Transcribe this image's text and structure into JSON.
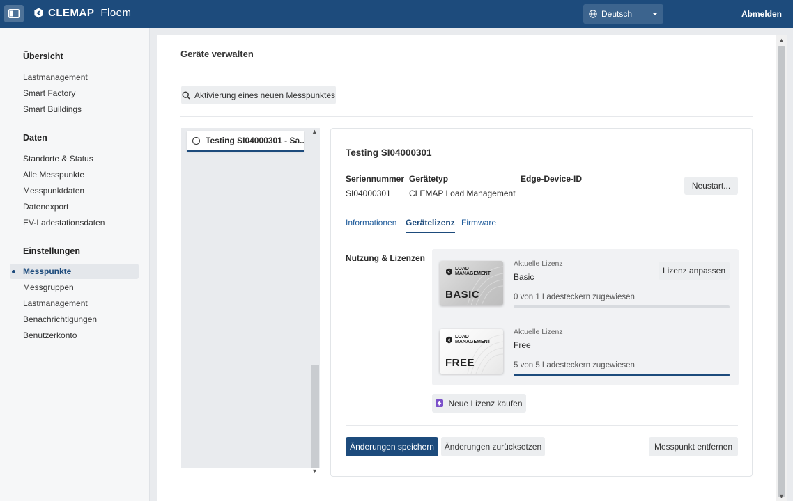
{
  "topbar": {
    "brand_name": "CLEMAP",
    "product_name": "Floem",
    "language": "Deutsch",
    "logout": "Abmelden",
    "accent_color": "#1d4b7c"
  },
  "sidebar": {
    "sections": [
      {
        "heading": "Übersicht",
        "items": [
          "Lastmanagement",
          "Smart Factory",
          "Smart Buildings"
        ]
      },
      {
        "heading": "Daten",
        "items": [
          "Standorte & Status",
          "Alle Messpunkte",
          "Messpunktdaten",
          "Datenexport",
          "EV-Ladestationsdaten"
        ]
      },
      {
        "heading": "Einstellungen",
        "items": [
          "Messpunkte",
          "Messgruppen",
          "Lastmanagement",
          "Benachrichtigungen",
          "Benutzerkonto"
        ]
      }
    ],
    "active_item": "Messpunkte"
  },
  "main": {
    "title": "Geräte verwalten",
    "activate_button": "Aktivierung eines neuen Messpunktes",
    "list_item": "Testing SI04000301 - Sa..."
  },
  "device": {
    "title": "Testing SI04000301",
    "fields": {
      "serial_label": "Seriennummer",
      "serial_value": "SI04000301",
      "type_label": "Gerätetyp",
      "type_value": "CLEMAP Load Management",
      "edge_label": "Edge-Device-ID",
      "edge_value": ""
    },
    "restart_button": "Neustart...",
    "tabs": [
      "Informationen",
      "Gerätelizenz",
      "Firmware"
    ],
    "active_tab": "Gerätelizenz",
    "usage_heading": "Nutzung & Lizenzen",
    "card_logo_line1": "LOAD",
    "card_logo_line2": "MANAGEMENT",
    "licenses": [
      {
        "card_name": "BASIC",
        "caption": "Aktuelle Lizenz",
        "name": "Basic",
        "usage": "0 von 1 Ladesteckern zugewiesen",
        "used": 0,
        "total": 1,
        "adjust_button": "Lizenz anpassen"
      },
      {
        "card_name": "FREE",
        "caption": "Aktuelle Lizenz",
        "name": "Free",
        "usage": "5 von 5 Ladesteckern zugewiesen",
        "used": 5,
        "total": 5
      }
    ],
    "buy_button": "Neue Lizenz kaufen",
    "save_button": "Änderungen speichern",
    "reset_button": "Änderungen zurücksetzen",
    "remove_button": "Messpunkt entfernen"
  }
}
